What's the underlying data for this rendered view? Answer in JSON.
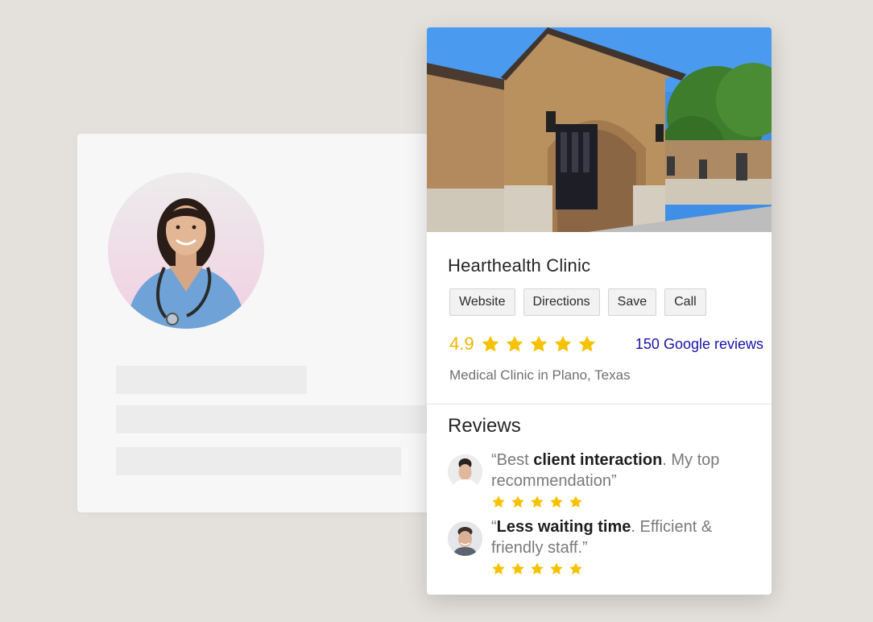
{
  "colors": {
    "star": "#f6c200",
    "rating": "#f2b400",
    "link": "#1a13a8",
    "background": "#e4e1dc"
  },
  "profile": {
    "avatar": "nurse-portrait"
  },
  "business": {
    "photo": "clinic-building-photo",
    "name": "Hearthealth Clinic",
    "buttons": {
      "website": "Website",
      "directions": "Directions",
      "save": "Save",
      "call": "Call"
    },
    "rating": "4.9",
    "rating_stars": 5,
    "reviews_link": "150 Google reviews",
    "category": "Medical Clinic in Plano, Texas"
  },
  "reviews_section": {
    "heading": "Reviews",
    "items": [
      {
        "open": "“Best ",
        "bold": "client interaction",
        "rest": ". My top recommendation”",
        "stars": 5
      },
      {
        "open": "“",
        "bold": "Less waiting time",
        "rest": ". Efficient & friendly staff.”",
        "stars": 5
      }
    ]
  }
}
